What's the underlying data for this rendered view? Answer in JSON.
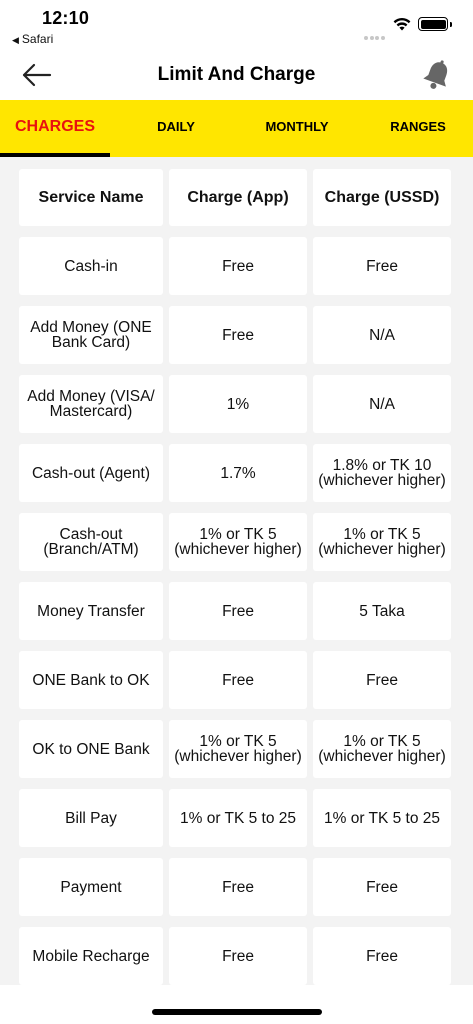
{
  "status_bar": {
    "time": "12:10",
    "back_app": "Safari",
    "back_icon": "triangle-left-icon",
    "icons": [
      "signal-icon",
      "wifi-icon",
      "battery-icon"
    ]
  },
  "header": {
    "title": "Limit And Charge",
    "back_icon": "arrow-left-icon",
    "bell_icon": "bell-icon"
  },
  "tabs": [
    {
      "label": "CHARGES",
      "active": true
    },
    {
      "label": "DAILY",
      "active": false
    },
    {
      "label": "MONTHLY",
      "active": false
    },
    {
      "label": "RANGES",
      "active": false
    }
  ],
  "colors": {
    "accent_yellow": "#ffe600",
    "active_tab_text": "#e8110f",
    "content_bg": "#f3f3f3"
  },
  "table": {
    "headers": [
      "Service Name",
      "Charge (App)",
      "Charge (USSD)"
    ],
    "rows": [
      [
        "Cash-in",
        "Free",
        "Free"
      ],
      [
        "Add Money (ONE Bank Card)",
        "Free",
        "N/A"
      ],
      [
        "Add Money (VISA/ Mastercard)",
        "1%",
        "N/A"
      ],
      [
        "Cash-out (Agent)",
        "1.7%",
        "1.8% or TK 10 (whichever higher)"
      ],
      [
        "Cash-out (Branch/ATM)",
        "1% or TK 5 (whichever higher)",
        "1% or TK 5 (whichever higher)"
      ],
      [
        "Money Transfer",
        "Free",
        "5 Taka"
      ],
      [
        "ONE Bank to OK",
        "Free",
        "Free"
      ],
      [
        "OK to ONE Bank",
        "1% or TK 5 (whichever higher)",
        "1% or TK 5 (whichever higher)"
      ],
      [
        "Bill Pay",
        "1% or TK 5 to 25",
        "1% or TK 5 to 25"
      ],
      [
        "Payment",
        "Free",
        "Free"
      ],
      [
        "Mobile Recharge",
        "Free",
        "Free"
      ]
    ]
  }
}
